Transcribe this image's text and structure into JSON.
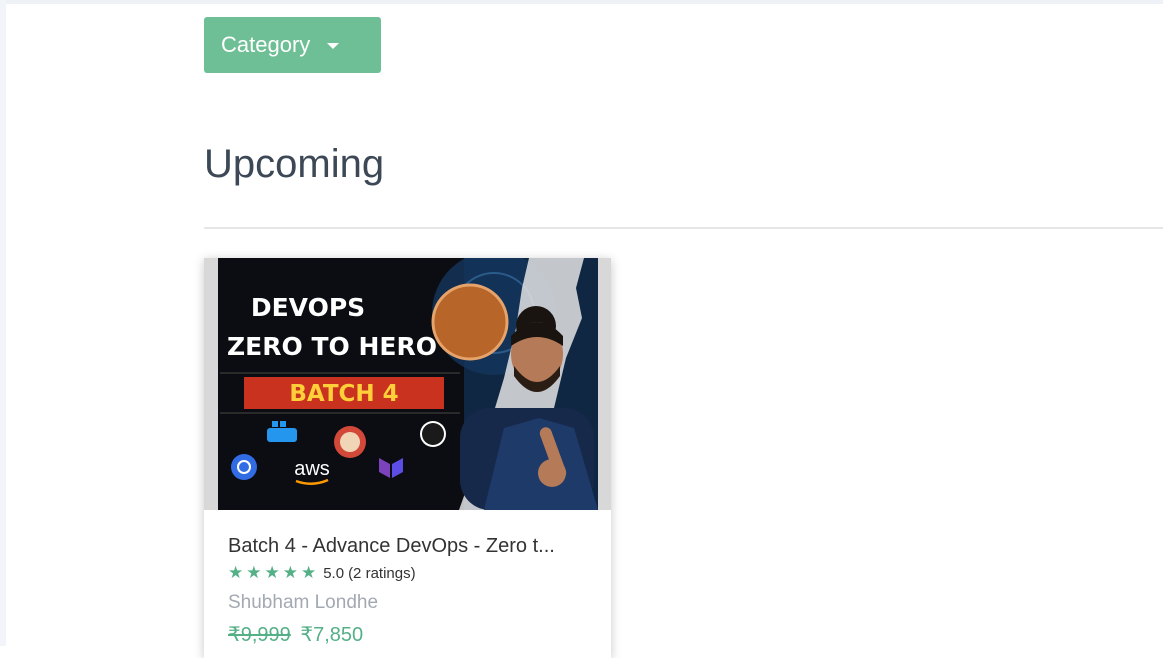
{
  "filter": {
    "category_label": "Category"
  },
  "section": {
    "title": "Upcoming"
  },
  "course": {
    "thumbnail": {
      "line1": "DEVOPS",
      "line2": "ZERO TO HERO",
      "line3": "BATCH 4",
      "aws": "aws"
    },
    "title": "Batch 4 - Advance DevOps - Zero t...",
    "stars": "★★★★★",
    "rating_value": "5.0",
    "rating_count": "(2 ratings)",
    "instructor": "Shubham Londhe",
    "old_price": "₹9,999",
    "new_price": "₹7,850"
  },
  "colors": {
    "accent": "#6ebf95",
    "star": "#55b087",
    "price": "#55b087",
    "banner_red": "#c8321e"
  }
}
